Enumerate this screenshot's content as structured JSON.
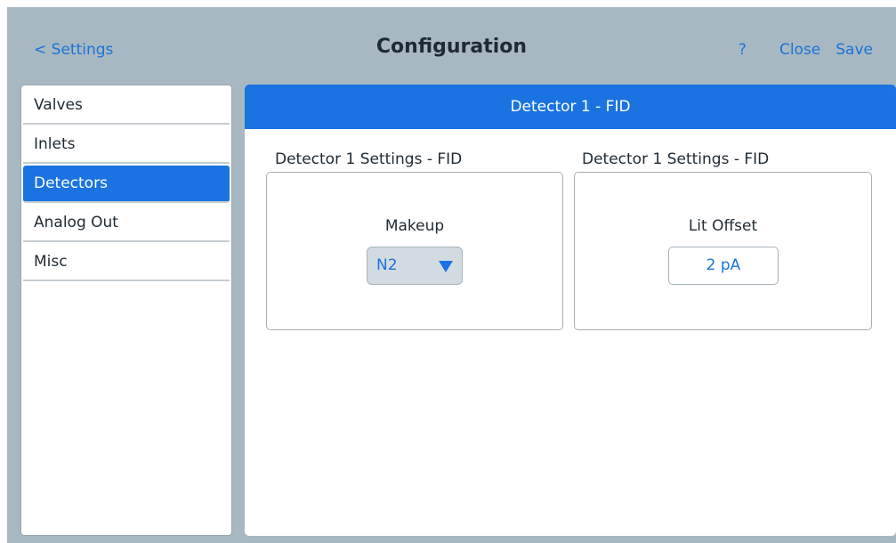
{
  "header": {
    "back_label": "< Settings",
    "title": "Configuration",
    "help_label": "?",
    "close_label": "Close",
    "save_label": "Save"
  },
  "sidebar": {
    "items": [
      {
        "label": "Valves"
      },
      {
        "label": "Inlets"
      },
      {
        "label": "Detectors",
        "active": true
      },
      {
        "label": "Analog Out"
      },
      {
        "label": "Misc"
      }
    ]
  },
  "main": {
    "header": "Detector 1 - FID",
    "panels": [
      {
        "title": "Detector 1 Settings - FID",
        "field_label": "Makeup",
        "value": "N2",
        "control": "dropdown",
        "icon": "chevron-down-icon"
      },
      {
        "title": "Detector 1 Settings - FID",
        "field_label": "Lit Offset",
        "value": "2 pA",
        "control": "value-box"
      }
    ]
  },
  "colors": {
    "accent": "#1a73e0",
    "chrome": "#a8b8c2",
    "link": "#1a73d9"
  }
}
